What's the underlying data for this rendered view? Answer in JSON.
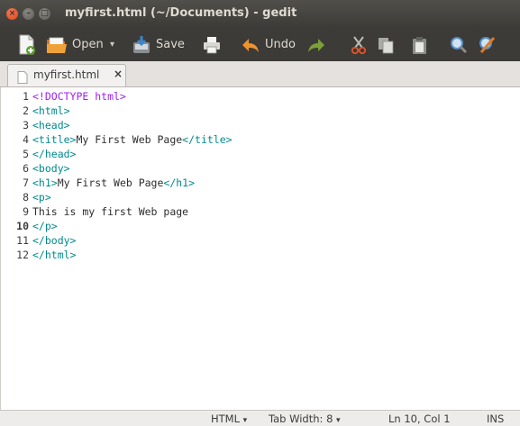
{
  "window": {
    "title": "myfirst.html (~/Documents) - gedit"
  },
  "toolbar": {
    "open_label": "Open",
    "open_arrow": "▾",
    "save_label": "Save",
    "undo_label": "Undo"
  },
  "tabs": [
    {
      "label": "myfirst.html",
      "close": "×"
    }
  ],
  "editor": {
    "line_numbers": [
      "1",
      "2",
      "3",
      "4",
      "5",
      "6",
      "7",
      "8",
      "9",
      "10",
      "11",
      "12"
    ],
    "current_line": "10",
    "lines": [
      [
        {
          "t": "<!DOCTYPE html>",
          "c": "kw"
        }
      ],
      [
        {
          "t": "<html>",
          "c": "tg"
        }
      ],
      [
        {
          "t": "<head>",
          "c": "tg"
        }
      ],
      [
        {
          "t": "<title>",
          "c": "tg"
        },
        {
          "t": "My First Web Page",
          "c": "tx"
        },
        {
          "t": "</title>",
          "c": "tg"
        }
      ],
      [
        {
          "t": "</head>",
          "c": "tg"
        }
      ],
      [
        {
          "t": "<body>",
          "c": "tg"
        }
      ],
      [
        {
          "t": "<h1>",
          "c": "tg"
        },
        {
          "t": "My First Web Page",
          "c": "tx"
        },
        {
          "t": "</h1>",
          "c": "tg"
        }
      ],
      [
        {
          "t": "<p>",
          "c": "tg"
        }
      ],
      [
        {
          "t": "This is my first Web page",
          "c": "tx"
        }
      ],
      [
        {
          "t": "</p>",
          "c": "tg"
        }
      ],
      [
        {
          "t": "</body>",
          "c": "tg"
        }
      ],
      [
        {
          "t": "</html>",
          "c": "tg"
        }
      ]
    ]
  },
  "statusbar": {
    "language": "HTML",
    "language_arrow": "▾",
    "tab_width": "Tab Width: 8",
    "tab_width_arrow": "▾",
    "cursor": "Ln 10, Col 1",
    "mode": "INS"
  },
  "colors": {
    "keyword": "#a020f0",
    "tag": "#008a8c",
    "text": "#2d2d2d",
    "close_button": "#e2552b",
    "titlebar": "#3c3b37"
  },
  "icons": [
    "close-icon",
    "minimize-icon",
    "maximize-icon",
    "new-document-icon",
    "open-folder-icon",
    "save-icon",
    "print-icon",
    "undo-icon",
    "redo-icon",
    "cut-icon",
    "copy-icon",
    "paste-icon",
    "search-icon",
    "replace-icon",
    "document-icon"
  ]
}
